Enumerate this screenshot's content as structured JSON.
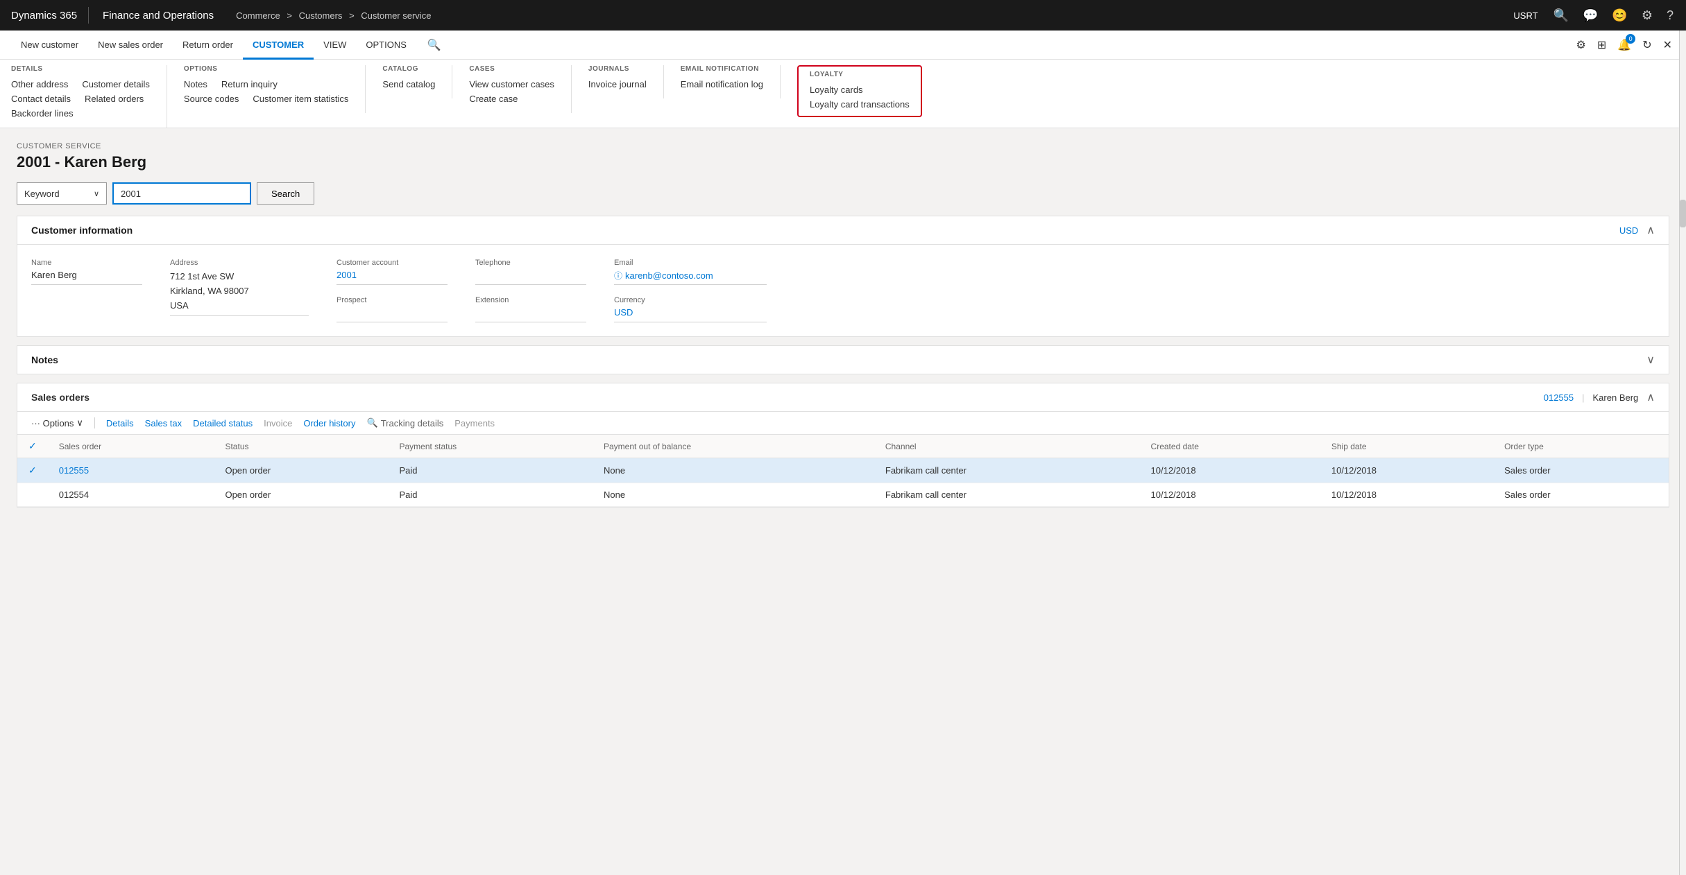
{
  "topnav": {
    "brand_d365": "Dynamics 365",
    "brand_fo": "Finance and Operations",
    "breadcrumb": [
      "Commerce",
      "Customers",
      "Customer service"
    ],
    "user": "USRT",
    "icons": {
      "search": "🔍",
      "chat": "💬",
      "face": "😊",
      "settings": "⚙",
      "help": "?"
    }
  },
  "ribbon": {
    "tabs": [
      {
        "id": "new-customer",
        "label": "New customer",
        "active": false
      },
      {
        "id": "new-sales-order",
        "label": "New sales order",
        "active": false
      },
      {
        "id": "return-order",
        "label": "Return order",
        "active": false
      },
      {
        "id": "customer",
        "label": "CUSTOMER",
        "active": true
      },
      {
        "id": "view",
        "label": "VIEW",
        "active": false
      },
      {
        "id": "options",
        "label": "OPTIONS",
        "active": false
      }
    ],
    "right_icons": {
      "customize": "⚙",
      "apps": "⊞",
      "notifications": "🔔",
      "notification_count": "0",
      "refresh": "↻",
      "close": "✕"
    }
  },
  "command": {
    "sections": [
      {
        "id": "details",
        "header": "DETAILS",
        "items": [
          [
            "Other address",
            "Customer details"
          ],
          [
            "Contact details",
            "Related orders"
          ],
          [
            "Backorder lines",
            ""
          ]
        ]
      },
      {
        "id": "options",
        "header": "OPTIONS",
        "items": [
          [
            "Notes",
            "Return inquiry"
          ],
          [
            "Source codes",
            "Customer item statistics"
          ]
        ]
      },
      {
        "id": "catalog",
        "header": "CATALOG",
        "items": [
          [
            "Send catalog"
          ]
        ]
      },
      {
        "id": "cases",
        "header": "CASES",
        "items": [
          [
            "View customer cases"
          ],
          [
            "Create case"
          ]
        ]
      },
      {
        "id": "journals",
        "header": "JOURNALS",
        "items": [
          [
            "Invoice journal"
          ]
        ]
      },
      {
        "id": "email",
        "header": "EMAIL NOTIFICATION",
        "items": [
          [
            "Email notification log"
          ]
        ]
      },
      {
        "id": "loyalty",
        "header": "LOYALTY",
        "items": [
          [
            "Loyalty cards"
          ],
          [
            "Loyalty card transactions"
          ]
        ],
        "highlighted": true
      }
    ]
  },
  "page": {
    "subtitle": "CUSTOMER SERVICE",
    "title": "2001 - Karen Berg"
  },
  "search": {
    "keyword_label": "Keyword",
    "search_value": "2001",
    "search_button": "Search",
    "placeholder": "Search"
  },
  "customer_info": {
    "section_title": "Customer information",
    "currency_link": "USD",
    "fields": {
      "name_label": "Name",
      "name_value": "Karen Berg",
      "address_label": "Address",
      "address_line1": "712 1st Ave SW",
      "address_line2": "Kirkland, WA 98007",
      "address_line3": "USA",
      "account_label": "Customer account",
      "account_value": "2001",
      "telephone_label": "Telephone",
      "telephone_value": "",
      "email_label": "Email",
      "email_value": "karenb@contoso.com",
      "prospect_label": "Prospect",
      "prospect_value": "",
      "extension_label": "Extension",
      "extension_value": "",
      "currency_label": "Currency",
      "currency_value": "USD"
    }
  },
  "notes": {
    "section_title": "Notes"
  },
  "sales_orders": {
    "section_title": "Sales orders",
    "order_link": "012555",
    "customer_name": "Karen Berg",
    "toolbar": {
      "options": "··· Options",
      "options_chevron": "∨",
      "details": "Details",
      "sales_tax": "Sales tax",
      "detailed_status": "Detailed status",
      "invoice": "Invoice",
      "order_history": "Order history",
      "tracking_details": "Tracking details",
      "payments": "Payments"
    },
    "columns": [
      {
        "id": "checkbox",
        "label": ""
      },
      {
        "id": "sales-order",
        "label": "Sales order"
      },
      {
        "id": "status",
        "label": "Status"
      },
      {
        "id": "payment-status",
        "label": "Payment status"
      },
      {
        "id": "payment-balance",
        "label": "Payment out of balance"
      },
      {
        "id": "channel",
        "label": "Channel"
      },
      {
        "id": "created-date",
        "label": "Created date"
      },
      {
        "id": "ship-date",
        "label": "Ship date"
      },
      {
        "id": "order-type",
        "label": "Order type"
      }
    ],
    "rows": [
      {
        "id": "row-1",
        "selected": true,
        "checkbox": true,
        "sales_order": "012555",
        "status": "Open order",
        "payment_status": "Paid",
        "payment_balance": "None",
        "channel": "Fabrikam call center",
        "created_date": "10/12/2018",
        "ship_date": "10/12/2018",
        "order_type": "Sales order"
      },
      {
        "id": "row-2",
        "selected": false,
        "checkbox": false,
        "sales_order": "012554",
        "status": "Open order",
        "payment_status": "Paid",
        "payment_balance": "None",
        "channel": "Fabrikam call center",
        "created_date": "10/12/2018",
        "ship_date": "10/12/2018",
        "order_type": "Sales order"
      }
    ]
  }
}
